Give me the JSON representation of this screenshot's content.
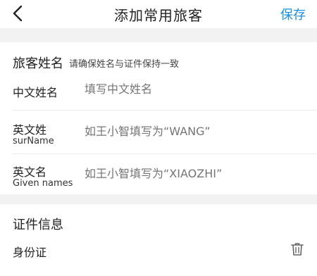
{
  "nav": {
    "title": "添加常用旅客",
    "save_label": "保存"
  },
  "name_section": {
    "title": "旅客姓名",
    "hint": "请确保姓名与证件保持一致",
    "fields": [
      {
        "label": "中文姓名",
        "sublabel": "",
        "placeholder": "填写中文姓名"
      },
      {
        "label": "英文姓",
        "sublabel": "surName",
        "placeholder": "如王小智填写为“WANG”"
      },
      {
        "label": "英文名",
        "sublabel": "Given names",
        "placeholder": "如王小智填写为“XIAOZHI”"
      }
    ]
  },
  "id_section": {
    "title": "证件信息",
    "id_type": "身份证"
  },
  "colors": {
    "accent": "#1b8fe8",
    "background_gap": "#f2f2f2",
    "placeholder": "#c8c8c8"
  }
}
